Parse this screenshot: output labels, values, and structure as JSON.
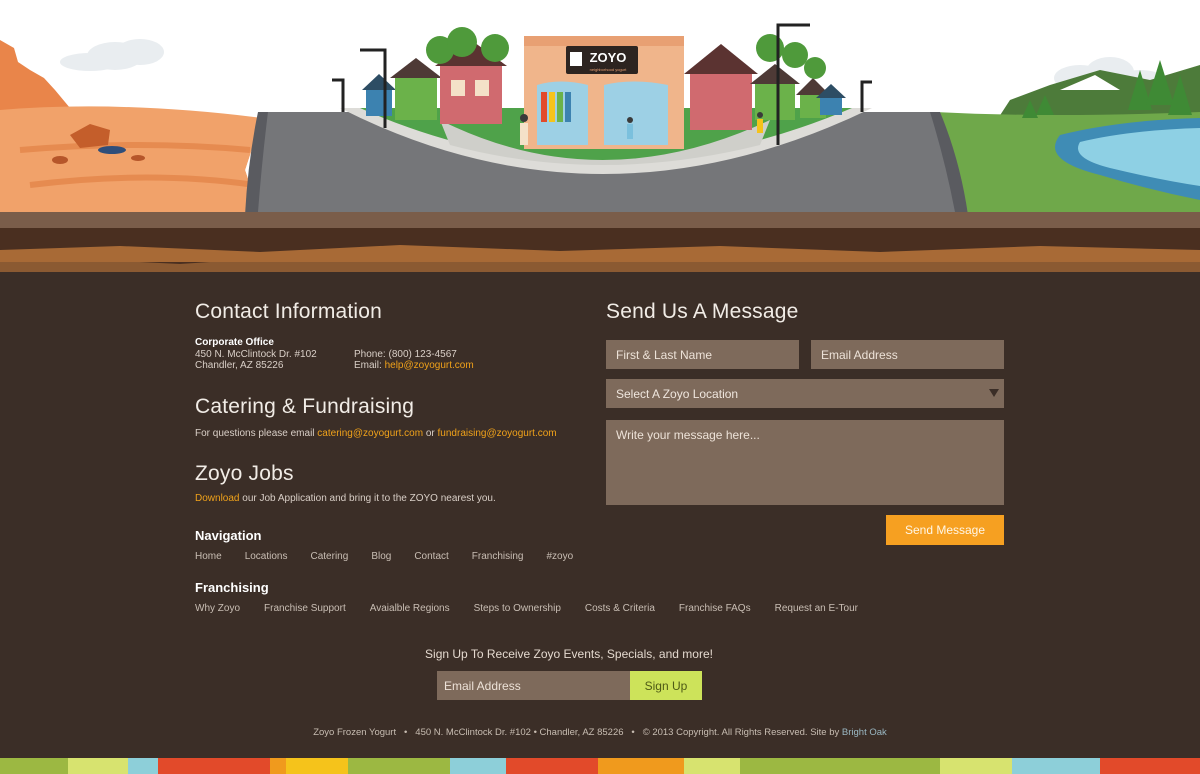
{
  "hero": {
    "logo_text": "ZOYO",
    "logo_tagline": "neighborhood yogurt"
  },
  "contact": {
    "heading": "Contact Information",
    "office_title": "Corporate Office",
    "address_line1": "450 N. McClintock Dr. #102",
    "address_line2": "Chandler, AZ 85226",
    "phone_label": "Phone:",
    "phone": "(800) 123-4567",
    "email_label": "Email:",
    "email": "help@zoyogurt.com"
  },
  "catering": {
    "heading": "Catering & Fundraising",
    "text_prefix": "For questions please email",
    "email1": "catering@zoyogurt.com",
    "joiner": "or",
    "email2": "fundraising@zoyogurt.com"
  },
  "jobs": {
    "heading": "Zoyo Jobs",
    "link": "Download",
    "text": "our Job Application and bring it to the ZOYO nearest you."
  },
  "navigation": {
    "title": "Navigation",
    "items": [
      "Home",
      "Locations",
      "Catering",
      "Blog",
      "Contact",
      "Franchising",
      "#zoyo"
    ]
  },
  "franchising": {
    "title": "Franchising",
    "items": [
      "Why Zoyo",
      "Franchise Support",
      "Avaialble Regions",
      "Steps to Ownership",
      "Costs & Criteria",
      "Franchise FAQs",
      "Request an E-Tour"
    ]
  },
  "form": {
    "heading": "Send Us A Message",
    "name_placeholder": "First & Last Name",
    "email_placeholder": "Email Address",
    "location_select": "Select A Zoyo Location",
    "message_placeholder": "Write your message here...",
    "send_label": "Send Message"
  },
  "newsletter": {
    "text": "Sign Up To Receive Zoyo Events, Specials, and more!",
    "input_placeholder": "Email Address",
    "button_label": "Sign Up"
  },
  "footer": {
    "company": "Zoyo Frozen Yogurt",
    "address": "450 N. McClintock Dr. #102 • Chandler, AZ 85226",
    "copyright": "© 2013 Copyright. All Rights Reserved. Site by",
    "site_by": "Bright Oak"
  },
  "colors": {
    "background": "#3b2e27",
    "accent_orange": "#f6a021",
    "accent_green": "#cde35a",
    "field_bg": "#7e6a5b",
    "stripe": [
      "#9cb842",
      "#d7e36f",
      "#8dcfd9",
      "#e24a2a",
      "#f09a1d",
      "#f5c31b",
      "#9cb842",
      "#8dcfd9",
      "#e24a2a",
      "#f09a1d",
      "#d7e36f",
      "#9cb842"
    ]
  }
}
